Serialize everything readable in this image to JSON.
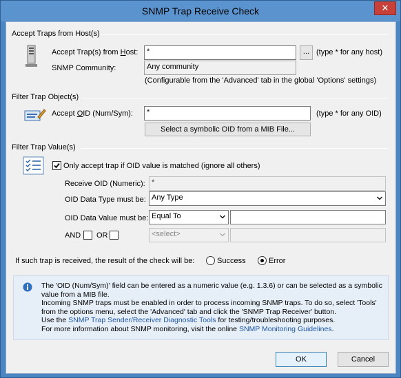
{
  "window": {
    "title": "SNMP Trap Receive Check",
    "close_label": "✕"
  },
  "host_group": {
    "title": "Accept Traps from Host(s)",
    "host_label_pre": "Accept Trap(s) from ",
    "host_label_ul": "H",
    "host_label_post": "ost:",
    "host_value": "*",
    "browse_label": "...",
    "host_hint": "(type * for any host)",
    "community_label": "SNMP Community:",
    "community_value": "Any community",
    "community_hint": "(Configurable from the 'Advanced' tab in the global 'Options' settings)"
  },
  "object_group": {
    "title": "Filter Trap Object(s)",
    "oid_label_pre": "Accept ",
    "oid_label_ul": "O",
    "oid_label_post": "ID (Num/Sym):",
    "oid_value": "*",
    "oid_hint": "(type * for any OID)",
    "mib_button": "Select a symbolic OID from a MIB File..."
  },
  "value_group": {
    "title": "Filter Trap Value(s)",
    "only_accept_label": "Only accept trap if OID value is matched (ignore all others)",
    "only_accept_checked": true,
    "receive_oid_label": "Receive OID (Numeric):",
    "receive_oid_value": "*",
    "data_type_label": "OID Data Type must be:",
    "data_type_value": "Any Type",
    "data_value_label": "OID Data Value must be:",
    "data_value_operator": "Equal To",
    "data_value_value": "",
    "and_label": "AND",
    "or_label": "OR",
    "select_placeholder": "<select>",
    "and_checked": false,
    "or_checked": false
  },
  "result": {
    "label": "If such trap is received, the result of the check will be:",
    "success_label": "Success",
    "error_label": "Error",
    "selected": "Error"
  },
  "info": {
    "line1": "The 'OID (Num/Sym)' field can be entered as a numeric value (e.g. 1.3.6) or can be selected as a symbolic value from a MIB file.",
    "line2": "Incoming SNMP traps must be enabled in order to process incoming SNMP traps. To do so, select 'Tools' from the options menu, select the 'Advanced' tab and click the 'SNMP Trap Receiver' button.",
    "line3_pre": "Use the ",
    "line3_link": "SNMP Trap Sender/Receiver Diagnostic Tools",
    "line3_post": "  for testing/troubleshooting purposes.",
    "line4_pre": "For more information about  SNMP monitoring, visit the online ",
    "line4_link": "SNMP Monitoring Guidelines",
    "line4_post": "."
  },
  "buttons": {
    "ok": "OK",
    "cancel": "Cancel"
  },
  "colors": {
    "title_bar": "#5b93ce",
    "close": "#c7413a",
    "link": "#1e56a8",
    "info_bg": "#e6eef7"
  }
}
